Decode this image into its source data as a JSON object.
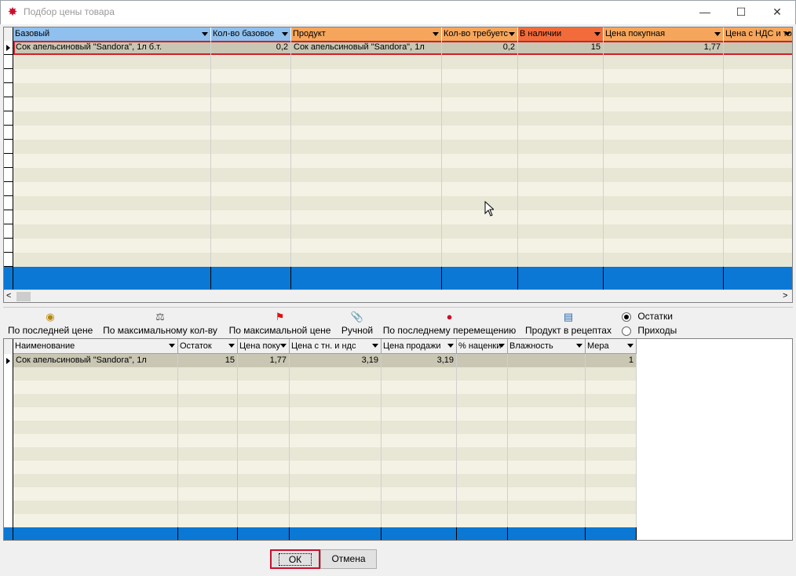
{
  "window": {
    "title": "Подбор цены товара",
    "controls": [
      "minimize",
      "maximize",
      "close"
    ]
  },
  "top_grid": {
    "columns": [
      {
        "label": "Базовый",
        "color": "#8fc0ee"
      },
      {
        "label": "Кол-во базовое",
        "color": "#8fc0ee"
      },
      {
        "label": "Продукт",
        "color": "#f6a65c"
      },
      {
        "label": "Кол-во требуетс",
        "color": "#f6a65c"
      },
      {
        "label": "В наличии",
        "color": "#f26b3a"
      },
      {
        "label": "Цена покупная",
        "color": "#f6a65c"
      },
      {
        "label": "Цена с НДС и тор",
        "color": "#f6a65c"
      }
    ],
    "rows": [
      [
        "Сок апельсиновый \"Sandora\", 1л б.т.",
        "0,2",
        "Сок апельсиновый \"Sandora\", 1л",
        "0,2",
        "15",
        "1,77",
        ""
      ]
    ]
  },
  "toolbar": {
    "buttons": [
      {
        "label": "По последней цене",
        "icon": "money-bag-icon"
      },
      {
        "label": "По максимальному кол-ву",
        "icon": "scales-icon"
      },
      {
        "label": "По максимальной цене",
        "icon": "red-flag-icon"
      },
      {
        "label": "Ручной",
        "icon": "paperclip-icon"
      },
      {
        "label": "По последнему перемещению",
        "icon": "cherry-icon"
      },
      {
        "label": "Продукт в рецептах",
        "icon": "document-list-icon"
      }
    ],
    "radios": [
      {
        "label": "Остатки",
        "checked": true
      },
      {
        "label": "Приходы",
        "checked": false
      }
    ]
  },
  "bottom_grid": {
    "columns": [
      "Наименование",
      "Остаток",
      "Цена поку",
      "Цена с тн. и ндс",
      "Цена продажи",
      "% наценки",
      "Влажность",
      "Мера"
    ],
    "rows": [
      [
        "Сок апельсиновый \"Sandora\", 1л",
        "15",
        "1,77",
        "3,19",
        "3,19",
        "",
        "",
        "1"
      ]
    ]
  },
  "buttons": {
    "ok": "ОК",
    "cancel": "Отмена"
  }
}
